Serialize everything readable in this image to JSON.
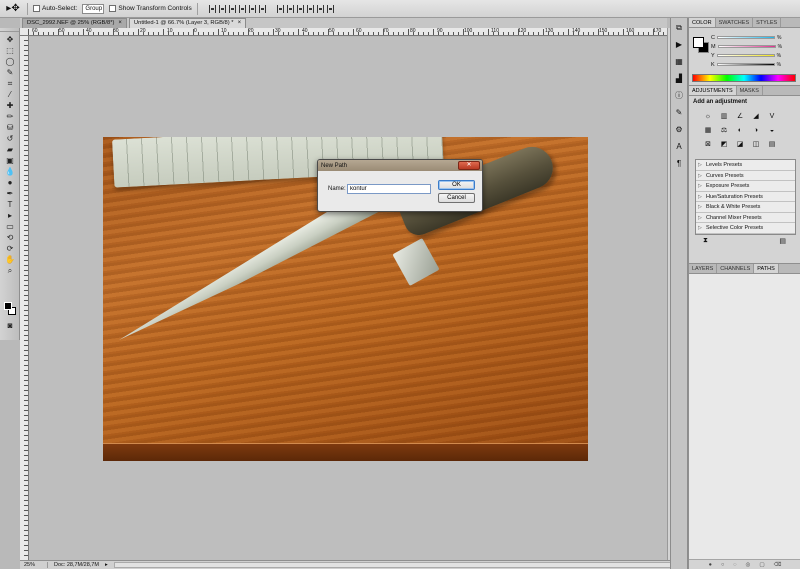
{
  "options_bar": {
    "tool_glyph": "▸✥",
    "auto_select_label": "Auto-Select:",
    "auto_select_value": "Group",
    "show_transform_label": "Show Transform Controls"
  },
  "tabs": [
    {
      "label": "DSC_2992.NEF @ 25% (RGB/8*)",
      "close": "×"
    },
    {
      "label": "Untitled-1 @ 66.7% (Layer 3, RGB/8) *",
      "close": "×"
    }
  ],
  "ruler_top_labels": [
    "60",
    "50",
    "40",
    "30",
    "20",
    "10",
    "0",
    "10",
    "20",
    "30",
    "40",
    "50",
    "60",
    "70",
    "80",
    "90",
    "100",
    "110",
    "120",
    "130",
    "140",
    "150",
    "160",
    "170"
  ],
  "dialog": {
    "title": "New Path",
    "close_glyph": "✕",
    "name_label": "Name:",
    "name_value": "kontur",
    "ok_label": "OK",
    "cancel_label": "Cancel"
  },
  "status": {
    "zoom": "25%",
    "doc": "Doc: 28,7M/28,7M"
  },
  "color_panel": {
    "tabs": [
      "COLOR",
      "SWATCHES",
      "STYLES"
    ],
    "channels": [
      {
        "letter": "C",
        "pct": "%",
        "color": "#21b5e8"
      },
      {
        "letter": "M",
        "pct": "%",
        "color": "#e0308f"
      },
      {
        "letter": "Y",
        "pct": "%",
        "color": "#f2e31c"
      },
      {
        "letter": "K",
        "pct": "%",
        "color": "#444444"
      }
    ]
  },
  "adjustments": {
    "tabs": [
      "ADJUSTMENTS",
      "MASKS"
    ],
    "title": "Add an adjustment",
    "icons": [
      "☼",
      "▥",
      "∠",
      "◢",
      "V",
      "▦",
      "⚖",
      "◐",
      "◑",
      "◒",
      "⊠",
      "◩",
      "◪",
      "◫",
      "▤"
    ],
    "presets": [
      "Levels Presets",
      "Curves Presets",
      "Exposure Presets",
      "Hue/Saturation Presets",
      "Black & White Presets",
      "Channel Mixer Presets",
      "Selective Color Presets"
    ]
  },
  "layers": {
    "tabs": [
      "LAYERS",
      "CHANNELS",
      "PATHS"
    ]
  }
}
